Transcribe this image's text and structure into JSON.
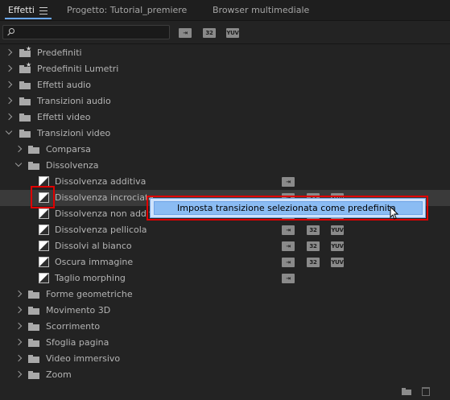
{
  "tabs": [
    {
      "label": "Effetti",
      "active": true
    },
    {
      "label": "Progetto: Tutorial_premiere",
      "active": false
    },
    {
      "label": "Browser multimediale",
      "active": false
    }
  ],
  "search": {
    "value": "",
    "placeholder": ""
  },
  "filters": [
    {
      "label": "⇥",
      "icon": "accelerated-effects-icon"
    },
    {
      "label": "32",
      "icon": "32bit-color-icon"
    },
    {
      "label": "YUV",
      "icon": "yuv-effects-icon"
    }
  ],
  "tree": [
    {
      "label": "Predefiniti",
      "type": "folder-star",
      "expanded": false,
      "level": 0
    },
    {
      "label": "Predefiniti Lumetri",
      "type": "folder-star",
      "expanded": false,
      "level": 0
    },
    {
      "label": "Effetti audio",
      "type": "folder",
      "expanded": false,
      "level": 0
    },
    {
      "label": "Transizioni audio",
      "type": "folder",
      "expanded": false,
      "level": 0
    },
    {
      "label": "Effetti video",
      "type": "folder",
      "expanded": false,
      "level": 0
    },
    {
      "label": "Transizioni video",
      "type": "folder",
      "expanded": true,
      "level": 0
    },
    {
      "label": "Comparsa",
      "type": "folder",
      "expanded": false,
      "level": 1
    },
    {
      "label": "Dissolvenza",
      "type": "folder",
      "expanded": true,
      "level": 1
    },
    {
      "label": "Dissolvenza additiva",
      "type": "transition",
      "level": 2,
      "badges": [
        "accel"
      ]
    },
    {
      "label": "Dissolvenza incrociata",
      "type": "transition",
      "level": 2,
      "badges": [
        "accel",
        "32",
        "yuv"
      ],
      "hover": true
    },
    {
      "label": "Dissolvenza non additiva",
      "type": "transition",
      "level": 2,
      "badges": [
        "accel",
        "32",
        "yuv"
      ]
    },
    {
      "label": "Dissolvenza pellicola",
      "type": "transition",
      "level": 2,
      "badges": [
        "accel",
        "32",
        "yuv"
      ]
    },
    {
      "label": "Dissolvi al bianco",
      "type": "transition",
      "level": 2,
      "badges": [
        "accel",
        "32",
        "yuv"
      ]
    },
    {
      "label": "Oscura immagine",
      "type": "transition",
      "level": 2,
      "badges": [
        "accel",
        "32",
        "yuv"
      ]
    },
    {
      "label": "Taglio morphing",
      "type": "transition",
      "level": 2,
      "badges": [
        "accel"
      ]
    },
    {
      "label": "Forme geometriche",
      "type": "folder",
      "expanded": false,
      "level": 1
    },
    {
      "label": "Movimento 3D",
      "type": "folder",
      "expanded": false,
      "level": 1
    },
    {
      "label": "Scorrimento",
      "type": "folder",
      "expanded": false,
      "level": 1
    },
    {
      "label": "Sfoglia pagina",
      "type": "folder",
      "expanded": false,
      "level": 1
    },
    {
      "label": "Video immersivo",
      "type": "folder",
      "expanded": false,
      "level": 1
    },
    {
      "label": "Zoom",
      "type": "folder",
      "expanded": false,
      "level": 1
    }
  ],
  "badge_text": {
    "accel": "⇥",
    "32": "32",
    "yuv": "YUV"
  },
  "context_menu": {
    "items": [
      {
        "label": "Imposta transizione selezionata come predefinita"
      }
    ]
  },
  "footer": {
    "icons": [
      "new-bin-icon",
      "delete-icon"
    ]
  },
  "colors": {
    "accent": "#6aa8f5",
    "highlight_box": "#e00000",
    "menu_item": "#8bbcf3"
  }
}
